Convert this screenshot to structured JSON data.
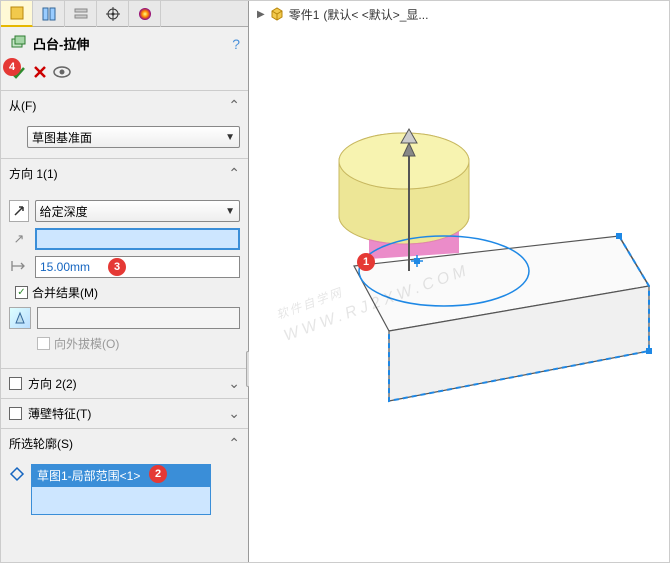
{
  "tabs": [
    "feature",
    "property",
    "config",
    "eval",
    "appearance"
  ],
  "feature": {
    "title": "凸台-拉伸",
    "help": "?"
  },
  "actions": {
    "ok_marker": "4"
  },
  "from": {
    "header": "从(F)",
    "plane": "草图基准面"
  },
  "dir1": {
    "header": "方向 1(1)",
    "end_condition": "给定深度",
    "depth_value": "15.00mm",
    "depth_marker": "3",
    "merge_label": "合并结果(M)",
    "merge_checked": true,
    "draft_label": "向外拔模(O)",
    "draft_checked": false
  },
  "dir2": {
    "header": "方向 2(2)"
  },
  "thin": {
    "header": "薄壁特征(T)"
  },
  "contour": {
    "header": "所选轮廓(S)",
    "selection": "草图1-局部范围<1>",
    "marker": "2"
  },
  "breadcrumb": {
    "part": "零件1",
    "config": "(默认< <默认>_显..."
  },
  "viewport": {
    "marker1": "1"
  },
  "watermark": {
    "main": "软件自学网",
    "sub": "WWW.RJ2XW.COM"
  }
}
